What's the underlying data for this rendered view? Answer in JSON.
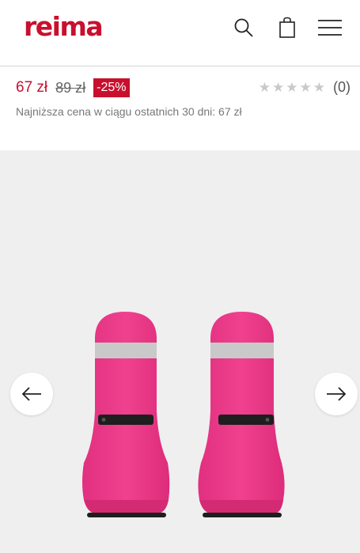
{
  "brand": {
    "name": "reima",
    "color": "#c8102e"
  },
  "header": {
    "icons": [
      "search-icon",
      "shopping-bag-icon",
      "menu-icon"
    ]
  },
  "product": {
    "price_current": "67 zł",
    "price_old": "89 zł",
    "discount": "-25%",
    "rating_stars": 0,
    "rating_max": 5,
    "rating_count": "(0)",
    "lowest_price_note": "Najniższa cena w ciągu ostatnich 30 dni: 67 zł"
  },
  "gallery": {
    "product_color": "#ec3a8c",
    "prev_icon": "arrow-left-icon",
    "next_icon": "arrow-right-icon"
  }
}
